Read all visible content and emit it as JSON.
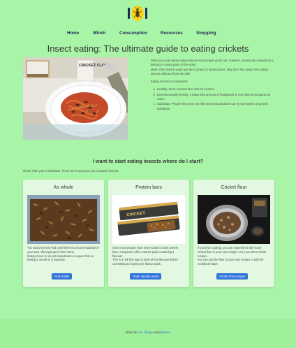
{
  "nav": [
    "Home",
    "Which",
    "Consumption",
    "Resources",
    "Shopping"
  ],
  "title": "Insect eating: The ultimate guide to eating crickets",
  "intro": {
    "p1": "When you hear about eating insects most people gross out. However, insects are considered a delicacy in many parts of the world.",
    "p2": "Most of the insects eaten are farm grown. In some places, they don't shy away from eating insects collected from the wild.",
    "p3": "Eating insects is considered:",
    "list": [
      "Healthy: Since insects have less fat content.",
      "Environmentally friendly: It takes less amount of food/plants to rear insects compared to cows.",
      "Substitute: People who don't eat milk and meat products can try out insects as protein substitute."
    ]
  },
  "section_title": "I want to start eating insects where do I start?",
  "lead": "Great! I like your enthusiasm. There are 3 ways you can consume insects:",
  "cards": [
    {
      "title": "As whole",
      "text": "You would need to find out if there is a local restaurant in your area offering bugs in their menu.\nEating insect is not yet mainstream so expect this as finding a needle in a haystack.",
      "button": "Find Hotels"
    },
    {
      "title": "Protein bars",
      "text": "Since most people have never tasted cricket protein bars, companies offer a starter pack containing 4 flavours.\nThis is a risk free way to taste all the flavours before committing to buying one flavour pack.",
      "button": "Order sample packs"
    },
    {
      "title": "Cricket flour",
      "text": "If you love cooking, you can experiment with some cricket flour in your own recipes or try out other cricket recipes.\nYou can add the flour to your own recipes to add the nutritional value.",
      "button": "Cricket flour recipes"
    }
  ],
  "footer": {
    "made_by": "Made by",
    "author": "evic mbugu",
    "using": "using",
    "framework": "Bulma",
    "end": "."
  },
  "images": {
    "hero_pack_label": "CRICKET FLOUR",
    "bar_brand": "CRICKET"
  },
  "colors": {
    "background": "#a9f5a7",
    "card": "#e2f8e1",
    "button": "#3273dc",
    "nav": "#1f2a5a"
  },
  "icons": [
    "cricket-logo-icon"
  ]
}
